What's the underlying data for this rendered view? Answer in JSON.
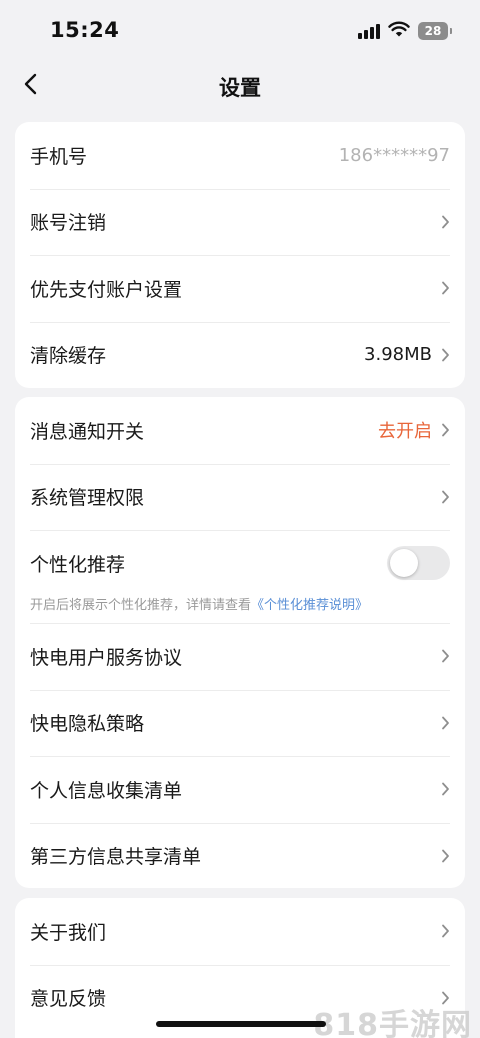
{
  "status": {
    "time": "15:24",
    "battery": "28"
  },
  "nav": {
    "title": "设置"
  },
  "group1": [
    {
      "label": "手机号",
      "value": "186******97"
    },
    {
      "label": "账号注销"
    },
    {
      "label": "优先支付账户设置"
    },
    {
      "label": "清除缓存",
      "value": "3.98MB"
    }
  ],
  "group2": {
    "notify": {
      "label": "消息通知开关",
      "value": "去开启"
    },
    "permission": {
      "label": "系统管理权限"
    },
    "personalize": {
      "label": "个性化推荐",
      "enabled": false,
      "note": "开启后将展示个性化推荐，详情请查看",
      "link": "《个性化推荐说明》"
    },
    "rest": [
      {
        "label": "快电用户服务协议"
      },
      {
        "label": "快电隐私策略"
      },
      {
        "label": "个人信息收集清单"
      },
      {
        "label": "第三方信息共享清单"
      }
    ]
  },
  "group3": [
    {
      "label": "关于我们"
    },
    {
      "label": "意见反馈"
    }
  ],
  "watermark": "818手游网",
  "colors": {
    "accent": "#e8663a",
    "link": "#5a8fd6",
    "background": "#f2f2f4"
  }
}
